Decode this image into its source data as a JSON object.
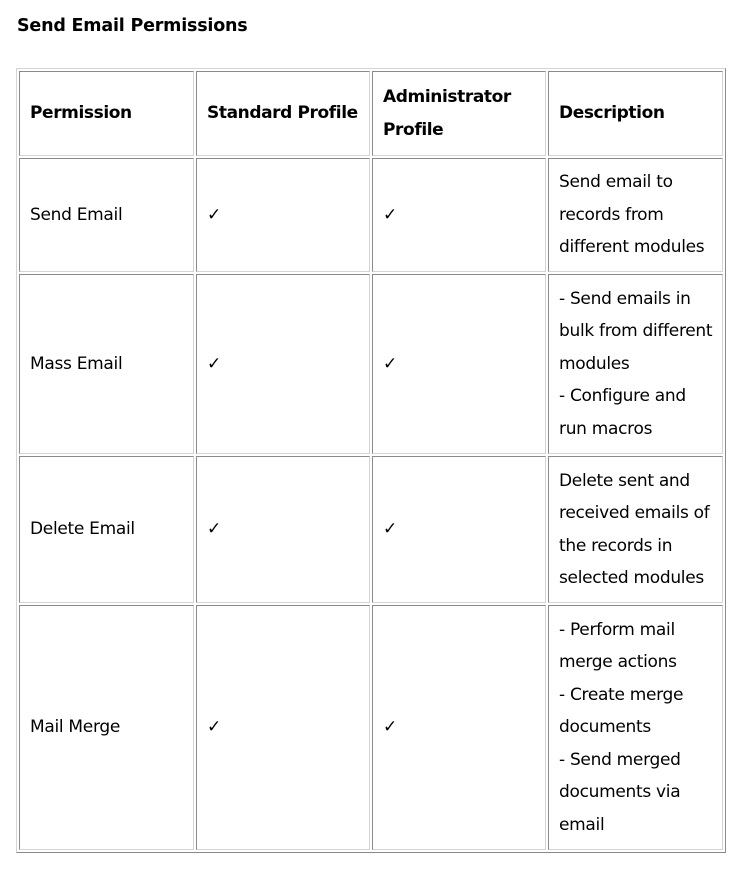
{
  "title": "Send Email Permissions",
  "table": {
    "headers": [
      "Permission",
      "Standard Profile",
      "Administrator Profile",
      "Description"
    ],
    "check_symbol": "✓",
    "rows": [
      {
        "permission": "Send Email",
        "standard": "✓",
        "administrator": "✓",
        "description": [
          "Send email to records from different modules"
        ]
      },
      {
        "permission": "Mass Email",
        "standard": "✓",
        "administrator": "✓",
        "description": [
          "- Send emails in bulk from different modules",
          "- Configure and run macros"
        ]
      },
      {
        "permission": "Delete Email",
        "standard": "✓",
        "administrator": "✓",
        "description": [
          "Delete sent and received emails of the records in selected modules"
        ]
      },
      {
        "permission": "Mail Merge",
        "standard": "✓",
        "administrator": "✓",
        "description": [
          "- Perform mail merge actions",
          "- Create merge documents",
          "- Send merged documents via email"
        ]
      }
    ]
  }
}
